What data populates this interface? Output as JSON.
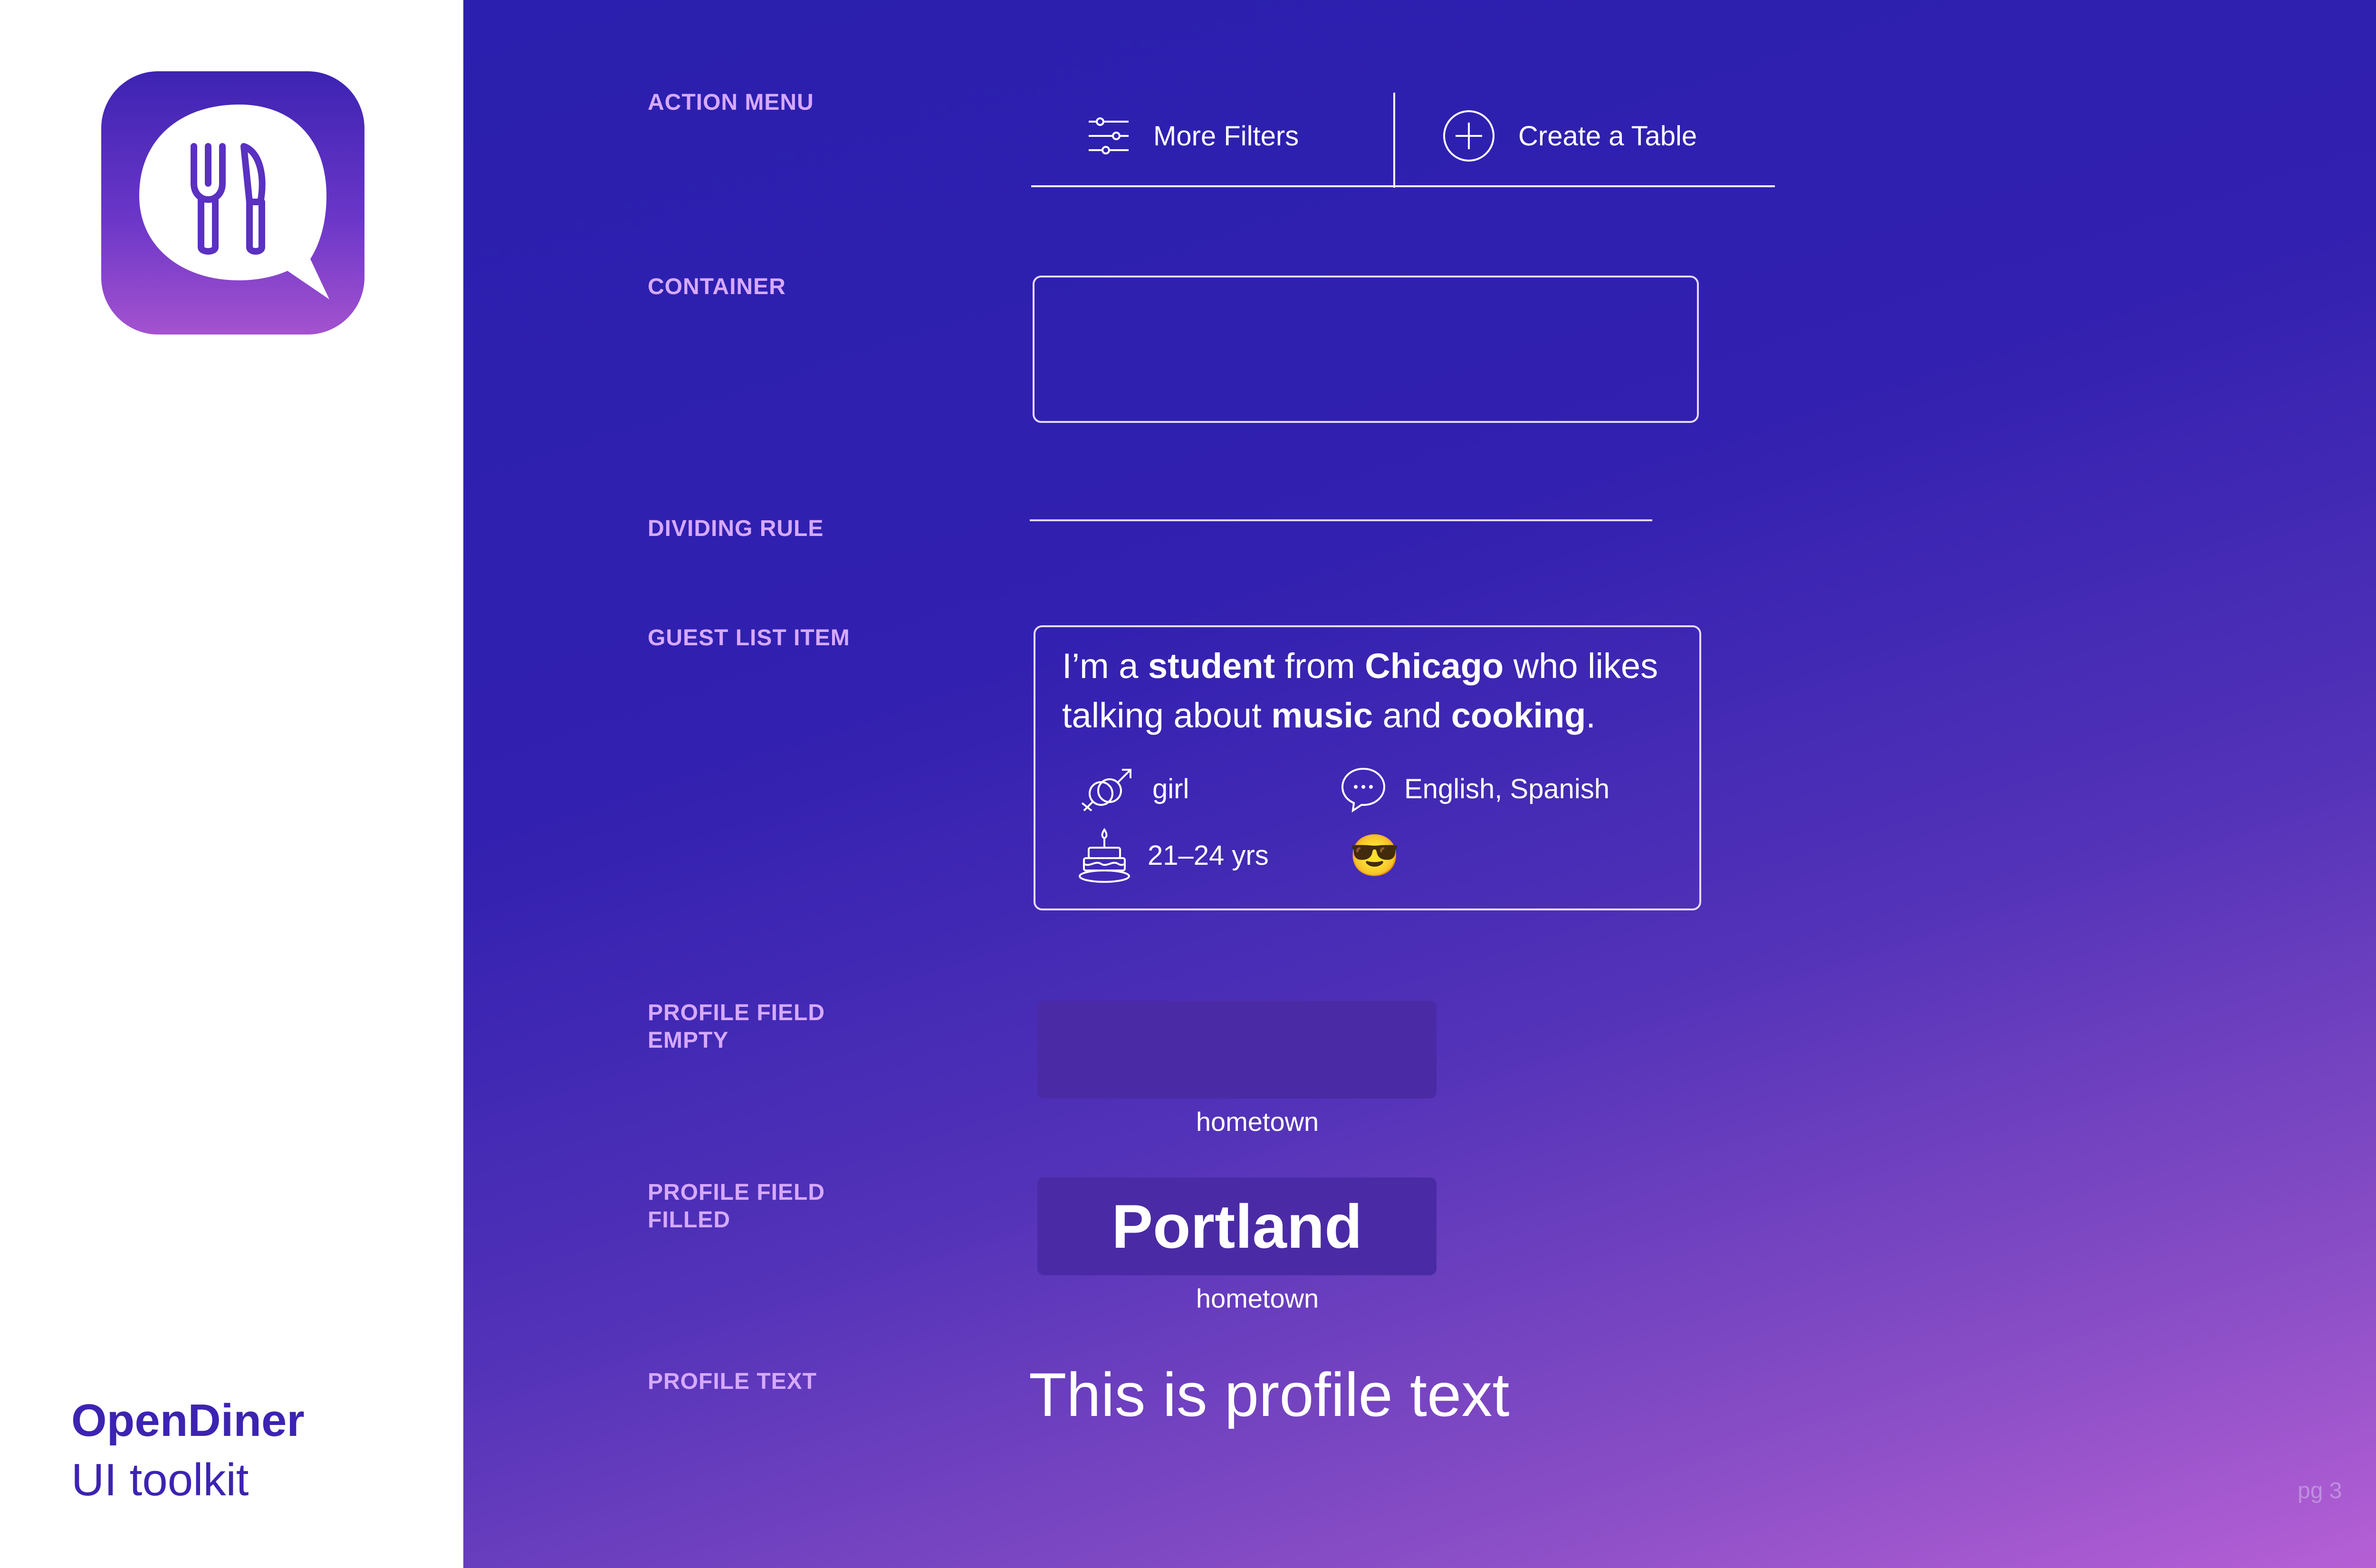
{
  "brand": {
    "name": "OpenDiner",
    "subtitle": "UI toolkit"
  },
  "labels": {
    "action_menu": "ACTION MENU",
    "container": "CONTAINER",
    "dividing_rule": "DIVIDING RULE",
    "guest_list_item": "GUEST LIST ITEM",
    "profile_field_empty_1": "PROFILE FIELD",
    "profile_field_empty_2": "EMPTY",
    "profile_field_filled_1": "PROFILE FIELD",
    "profile_field_filled_2": "FILLED",
    "profile_text": "PROFILE TEXT"
  },
  "action_menu": {
    "filters_label": "More Filters",
    "create_label": "Create a Table"
  },
  "guest": {
    "prefix": "I’m a ",
    "role": "student",
    "mid1": " from ",
    "city": "Chicago",
    "mid2": " who likes talking about ",
    "interest1": "music",
    "mid3": " and ",
    "interest2": "cooking",
    "suffix": ".",
    "gender": "girl",
    "languages": "English, Spanish",
    "age": "21–24 yrs",
    "mood_emoji": "😎"
  },
  "profile_field_empty": {
    "caption": "hometown"
  },
  "profile_field_filled": {
    "value": "Portland",
    "caption": "hometown"
  },
  "profile_text": "This is profile text",
  "page_number": "pg 3",
  "colors": {
    "brand": "#3d23b2",
    "label": "#d6a9ff",
    "field": "#4a2ba5"
  },
  "icons": [
    "fork-knife-icon",
    "sliders-icon",
    "plus-circle-icon",
    "gender-icon",
    "speech-bubble-icon",
    "birthday-cake-icon"
  ]
}
